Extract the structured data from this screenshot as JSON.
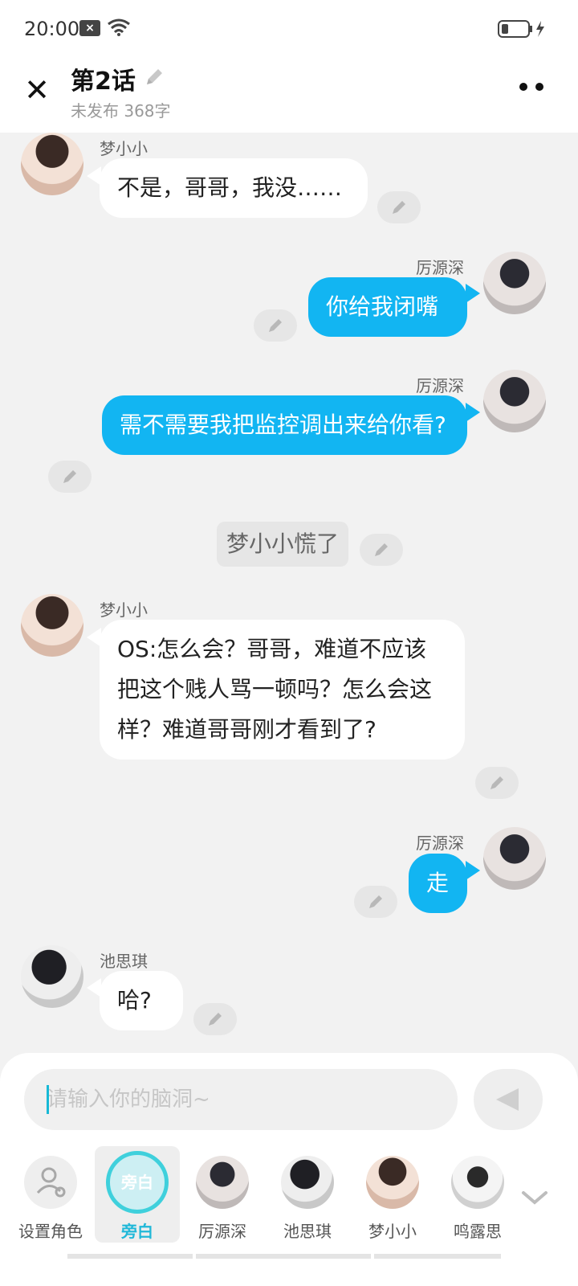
{
  "status_bar": {
    "time": "20:00"
  },
  "header": {
    "title": "第2话",
    "subtitle": "未发布 368字"
  },
  "messages": [
    {
      "side": "left",
      "sender": "梦小小",
      "text": "不是，哥哥，我没……"
    },
    {
      "side": "right",
      "sender": "厉源深",
      "text": "你给我闭嘴"
    },
    {
      "side": "right",
      "sender": "厉源深",
      "text": "需不需要我把监控调出来给你看?"
    },
    {
      "side": "narration",
      "sender": "",
      "text": "梦小小慌了"
    },
    {
      "side": "left",
      "sender": "梦小小",
      "text": "OS:怎么会？哥哥，难道不应该把这个贱人骂一顿吗？怎么会这样？难道哥哥刚才看到了?"
    },
    {
      "side": "right",
      "sender": "厉源深",
      "text": "走"
    },
    {
      "side": "left",
      "sender": "池思琪",
      "text": "哈?"
    }
  ],
  "composer": {
    "placeholder": "请输入你的脑洞~"
  },
  "roles": [
    {
      "label": "设置角色",
      "icon": "add-person-icon"
    },
    {
      "label": "旁白",
      "badge": "旁白",
      "selected": true
    },
    {
      "label": "厉源深"
    },
    {
      "label": "池思琪"
    },
    {
      "label": "梦小小"
    },
    {
      "label": "鸣露思"
    }
  ],
  "colors": {
    "accent": "#12b5f2",
    "role_selected": "#21b8d8",
    "background": "#f2f2f2"
  }
}
